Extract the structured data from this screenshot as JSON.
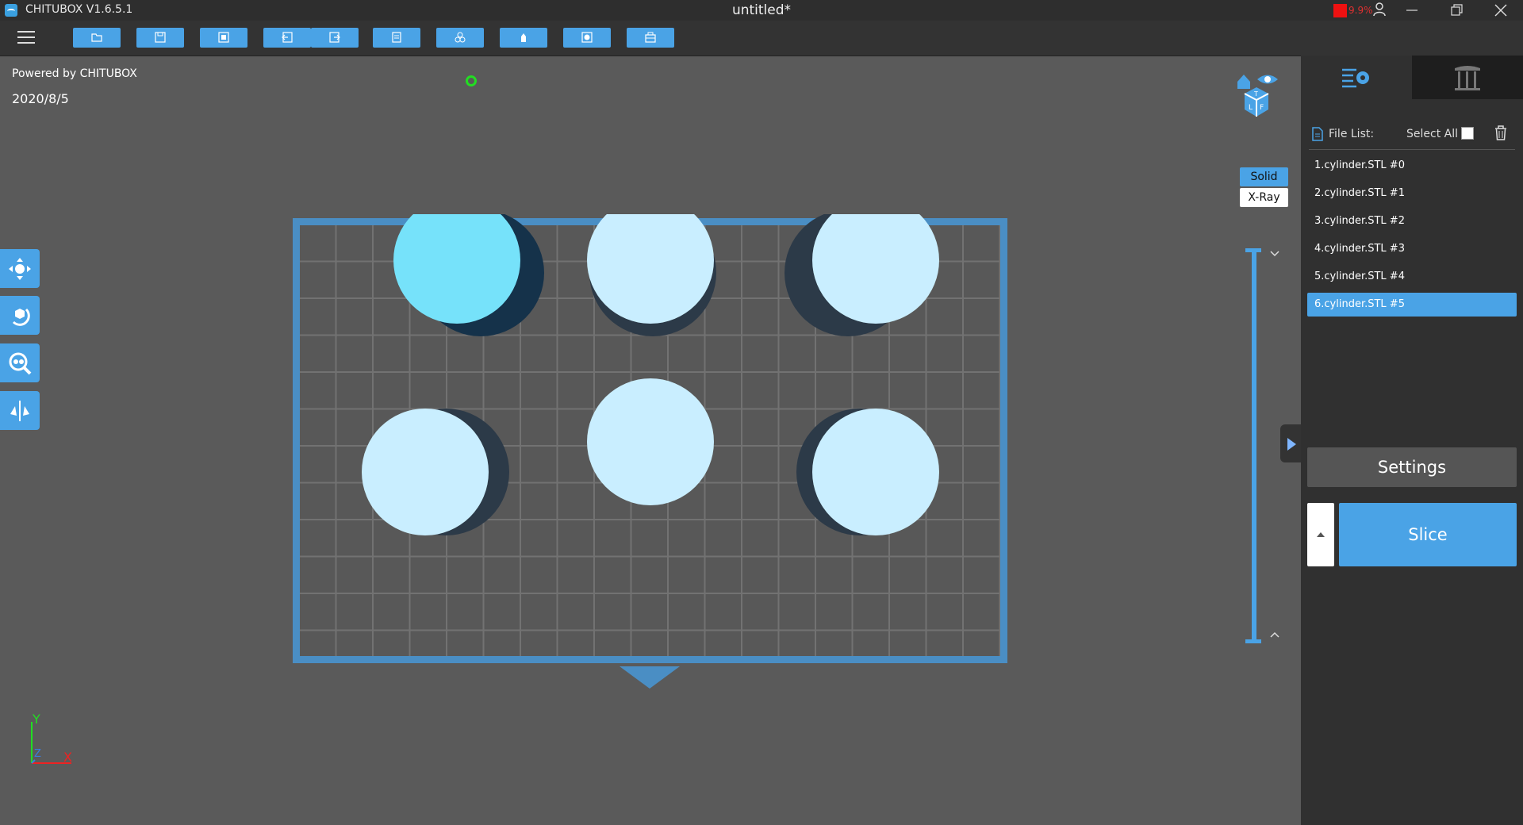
{
  "app": {
    "name": "CHITUBOX V1.6.5.1",
    "document_title": "untitled*",
    "perf_text": "9.9%"
  },
  "toolbar": {
    "buttons": [
      {
        "name": "open-file",
        "icon": "folder-icon"
      },
      {
        "name": "save-file",
        "icon": "save-icon"
      },
      {
        "name": "screenshot",
        "icon": "capture-icon"
      },
      {
        "name": "undo",
        "icon": "undo-icon"
      },
      {
        "name": "redo",
        "icon": "redo-icon"
      },
      {
        "name": "layout",
        "icon": "layout-icon"
      },
      {
        "name": "arrange",
        "icon": "arrange-icon"
      },
      {
        "name": "supports",
        "icon": "support-icon"
      },
      {
        "name": "hollow",
        "icon": "hollow-icon"
      },
      {
        "name": "print-settings",
        "icon": "printer-icon"
      }
    ]
  },
  "viewport": {
    "powered_by": "Powered by CHITUBOX",
    "date": "2020/8/5",
    "view_modes": {
      "solid": "Solid",
      "xray": "X-Ray",
      "active": "Solid"
    },
    "axis_labels": {
      "x": "X",
      "y": "Y",
      "z": "Z"
    },
    "colors": {
      "platform_frame": "#4a8ec4",
      "selected_model": "#76e2fa",
      "model": "#c9eeff",
      "accent": "#4aa3e6"
    }
  },
  "left_tools": [
    {
      "name": "move-tool",
      "icon": "move-icon"
    },
    {
      "name": "rotate-tool",
      "icon": "rotate-icon"
    },
    {
      "name": "scale-tool",
      "icon": "scale-icon"
    },
    {
      "name": "mirror-tool",
      "icon": "mirror-icon"
    }
  ],
  "panel": {
    "file_list_label": "File List:",
    "select_all_label": "Select All",
    "files": [
      {
        "label": "1.cylinder.STL #0",
        "selected": false
      },
      {
        "label": "2.cylinder.STL #1",
        "selected": false
      },
      {
        "label": "3.cylinder.STL #2",
        "selected": false
      },
      {
        "label": "4.cylinder.STL #3",
        "selected": false
      },
      {
        "label": "5.cylinder.STL #4",
        "selected": false
      },
      {
        "label": "6.cylinder.STL #5",
        "selected": true
      }
    ],
    "settings_label": "Settings",
    "slice_label": "Slice"
  }
}
